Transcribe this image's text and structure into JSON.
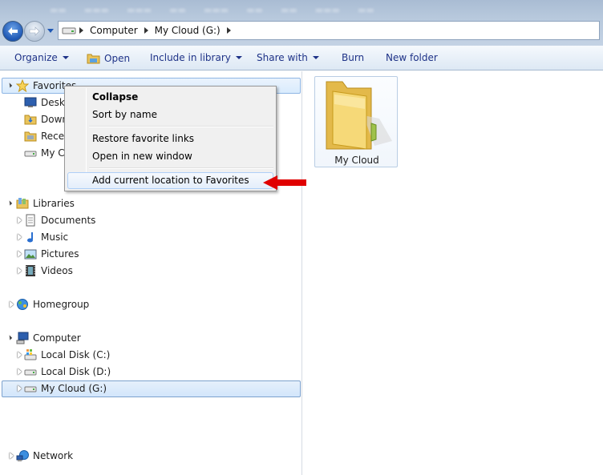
{
  "address": {
    "crumbs": [
      "Computer",
      "My Cloud (G:)"
    ]
  },
  "toolbar": {
    "organize": "Organize",
    "open": "Open",
    "include_in_library": "Include in library",
    "share_with": "Share with",
    "burn": "Burn",
    "new_folder": "New folder"
  },
  "nav": {
    "favorites": "Favorites",
    "favorites_items": [
      "Deskt",
      "Down",
      "Recer",
      "My C"
    ],
    "libraries": "Libraries",
    "libraries_items": [
      "Documents",
      "Music",
      "Pictures",
      "Videos"
    ],
    "homegroup": "Homegroup",
    "computer": "Computer",
    "computer_items": [
      "Local Disk (C:)",
      "Local Disk (D:)",
      "My Cloud (G:)"
    ],
    "network": "Network"
  },
  "context_menu": {
    "items": [
      "Collapse",
      "Sort by name",
      "Restore favorite links",
      "Open in new window",
      "Add current location to Favorites"
    ]
  },
  "content": {
    "folder_label": "My Cloud"
  },
  "colors": {
    "link_blue": "#1e3287",
    "annotation_arrow": "#e00000",
    "selection_border": "#7da2ce"
  }
}
